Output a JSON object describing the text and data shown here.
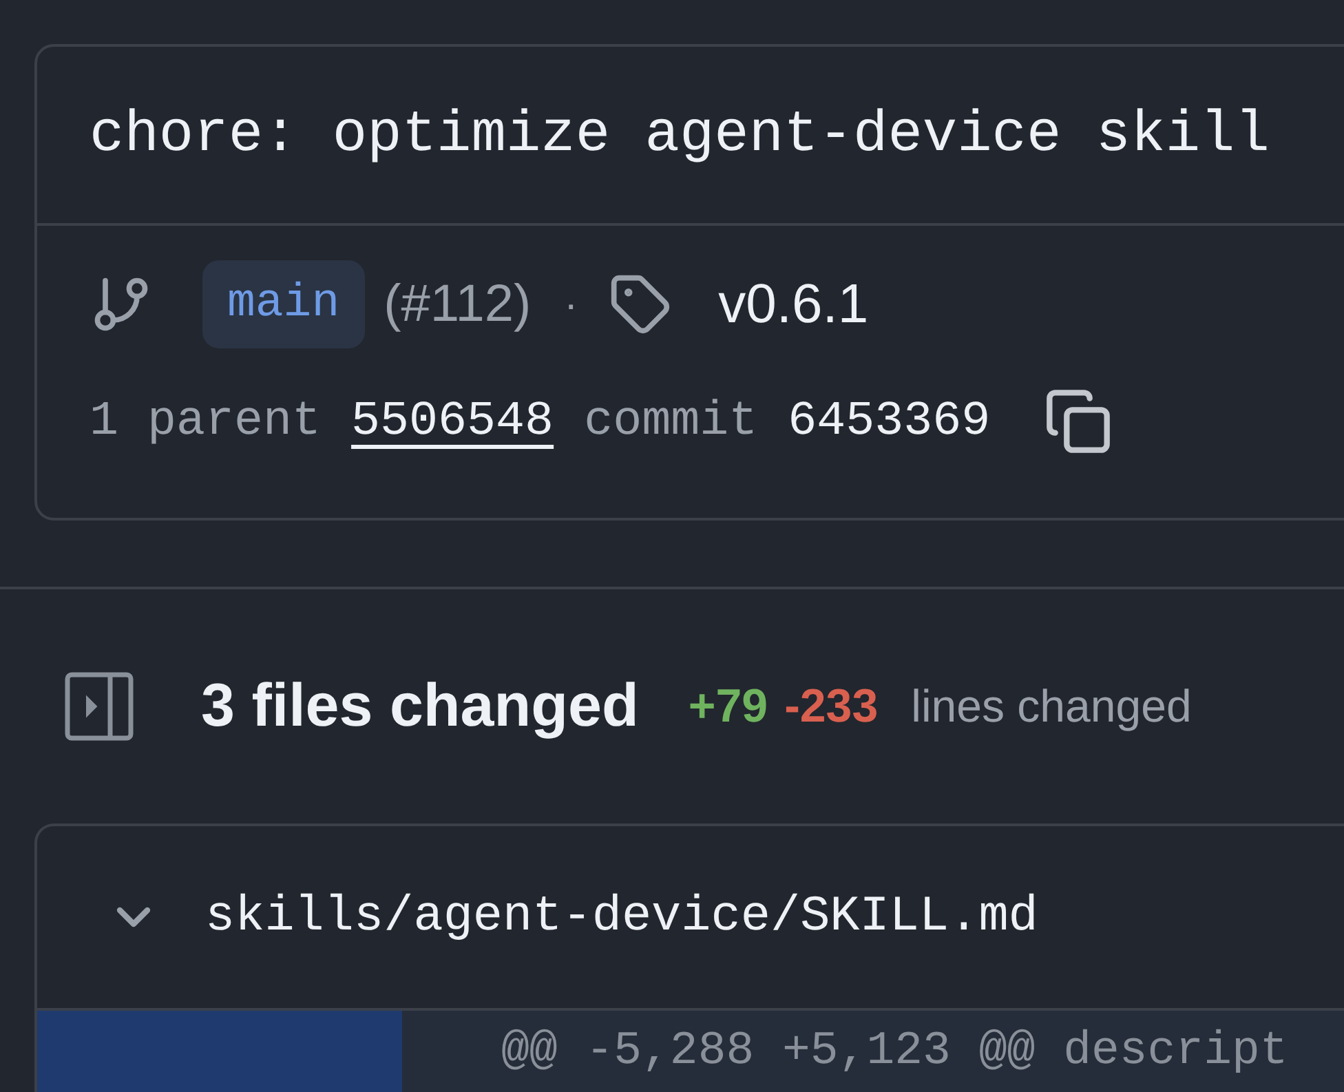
{
  "commit": {
    "message": "chore: optimize agent-device skill",
    "branch": "main",
    "pr": "(#112)",
    "separator": "·",
    "tag": "v0.6.1",
    "parent_label": "1 parent",
    "parent_sha": "5506548",
    "commit_label": "commit",
    "commit_sha": "6453369"
  },
  "summary": {
    "title": "3 files changed",
    "additions": "+79",
    "deletions": "-233",
    "suffix": "lines changed"
  },
  "files": [
    {
      "path": "skills/agent-device/SKILL.md",
      "expanded": true,
      "hunk": "@@ -5,288 +5,123 @@ descript"
    }
  ]
}
